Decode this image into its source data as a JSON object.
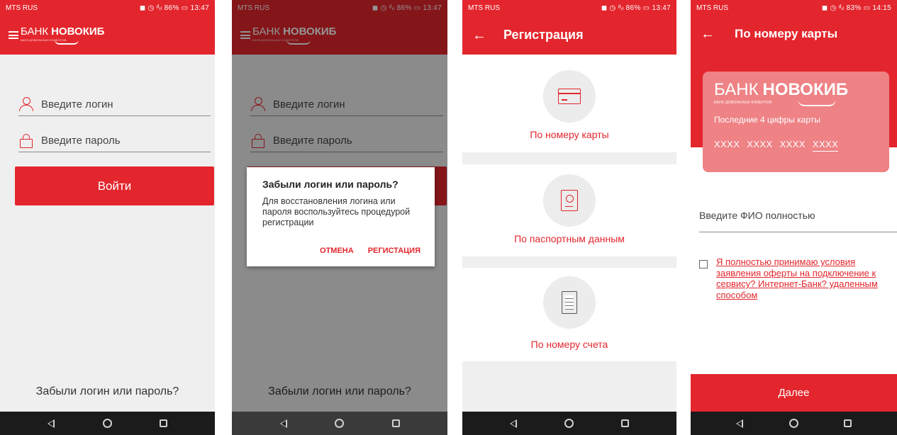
{
  "status": {
    "carrier": "MTS RUS",
    "screen1_right": "◼ ◷ ᵈᵢₗ 86% ▭ 13:47",
    "screen2_right": "◼ ◷ ᵈᵢₗ 86% ▭ 13:47",
    "screen3_right": "◼ ◷ ᵈᵢₗ 86% ▭ 13:47",
    "screen4_right": "◼ ◷ ᵈᵢₗ 83% ▭ 14:15"
  },
  "logo": {
    "word1": "БАНК",
    "word2": "НОВОКИБ",
    "tagline": "БАНК ДОВОЛЬНЫХ КЛИЕНТОВ"
  },
  "login": {
    "login_placeholder": "Введите логин",
    "password_placeholder": "Введите пароль",
    "login_button": "Войти",
    "forgot_link": "Забыли логин или пароль?"
  },
  "dialog": {
    "title": "Забыли логин или пароль?",
    "text": "Для восстановления логина или пароля воспользуйтесь процедурой регистрации",
    "cancel": "ОТМЕНА",
    "register": "РЕГИСТАЦИЯ"
  },
  "registration": {
    "title": "Регистрация",
    "options": [
      {
        "label": "По номеру карты",
        "icon": "card-icon"
      },
      {
        "label": "По паспортным данным",
        "icon": "passport-icon"
      },
      {
        "label": "По номеру счета",
        "icon": "document-icon"
      }
    ]
  },
  "card_screen": {
    "title": "По номеру карты",
    "card_hint": "Последние 4 цифры карты",
    "digits": [
      "XXXX",
      "XXXX",
      "XXXX",
      "XXXX"
    ],
    "fio_placeholder": "Введите ФИО полностью",
    "agreement": "Я полностью принимаю условия заявления оферты на подключение к сервису? Интернет-Банк? удаленным способом",
    "next_button": "Далее"
  },
  "colors": {
    "brand_red": "#e3262d",
    "card_pink": "#ee8285"
  }
}
